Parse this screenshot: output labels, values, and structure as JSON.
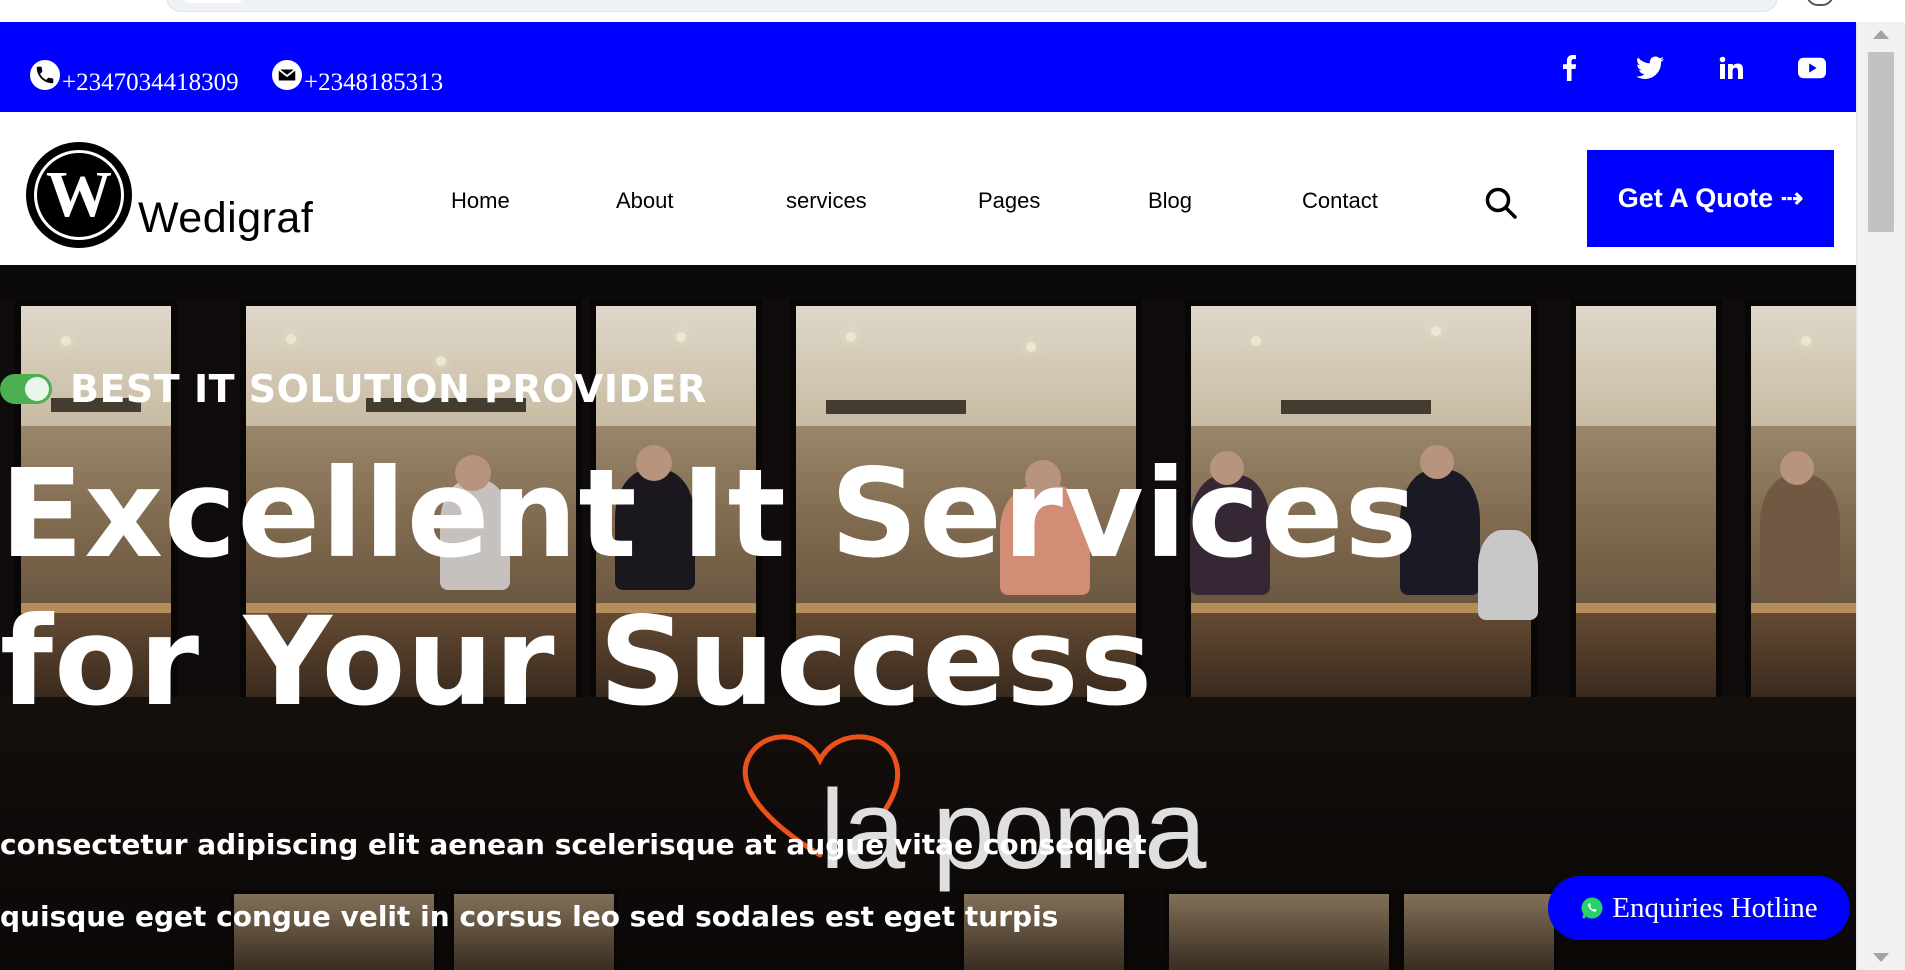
{
  "topbar": {
    "background": "#0000ff",
    "phone": {
      "icon": "phone-icon",
      "number": "+2347034418309"
    },
    "email": {
      "icon": "mail-icon",
      "number": "+2348185313"
    },
    "socials": [
      "facebook-icon",
      "twitter-icon",
      "linkedin-icon",
      "youtube-icon"
    ]
  },
  "brand": {
    "name": "Wedigraf",
    "logo_letter": "W"
  },
  "nav": {
    "items": [
      "Home",
      "About",
      "services",
      "Pages",
      "Blog",
      "Contact"
    ],
    "search_icon": "search-icon",
    "cta": "Get A Quote ⇢"
  },
  "hero": {
    "tagline": "BEST IT SOLUTION PROVIDER",
    "headline_line1": "Excellent It Services",
    "headline_line2": "for Your Success",
    "sub_line1": "consectetur adipiscing elit aenean scelerisque at augue vitae consequet",
    "sub_line2": "quisque eget congue velit in corsus leo sed sodales est eget turpis",
    "sign_text": "la poma",
    "toggle_color": "#4caf50"
  },
  "float": {
    "label": "Enquiries Hotline",
    "icon": "whatsapp-icon"
  }
}
